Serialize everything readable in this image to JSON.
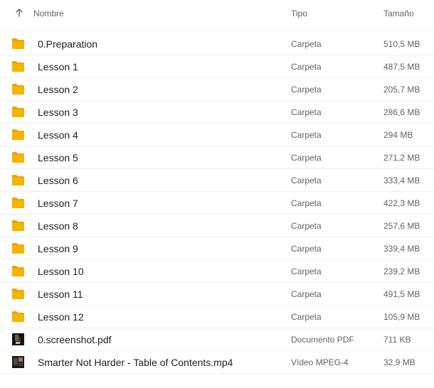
{
  "header": {
    "sort_icon": "arrow-up-icon",
    "name_label": "Nombre",
    "type_label": "Tipo",
    "size_label": "Tamaño"
  },
  "colors": {
    "folder": "#f5b400",
    "folder_dark": "#e8a200",
    "text": "#202124",
    "secondary_text": "#5f6368",
    "divider": "#eeeff1"
  },
  "items": [
    {
      "name": "0.Preparation",
      "type": "Carpeta",
      "size": "510,5 MB",
      "icon": "folder-icon"
    },
    {
      "name": "Lesson 1",
      "type": "Carpeta",
      "size": "487,5 MB",
      "icon": "folder-icon"
    },
    {
      "name": "Lesson 2",
      "type": "Carpeta",
      "size": "205,7 MB",
      "icon": "folder-icon"
    },
    {
      "name": "Lesson 3",
      "type": "Carpeta",
      "size": "286,6 MB",
      "icon": "folder-icon"
    },
    {
      "name": "Lesson 4",
      "type": "Carpeta",
      "size": "294 MB",
      "icon": "folder-icon"
    },
    {
      "name": "Lesson 5",
      "type": "Carpeta",
      "size": "271,2 MB",
      "icon": "folder-icon"
    },
    {
      "name": "Lesson 6",
      "type": "Carpeta",
      "size": "333,4 MB",
      "icon": "folder-icon"
    },
    {
      "name": "Lesson 7",
      "type": "Carpeta",
      "size": "422,3 MB",
      "icon": "folder-icon"
    },
    {
      "name": "Lesson 8",
      "type": "Carpeta",
      "size": "257,6 MB",
      "icon": "folder-icon"
    },
    {
      "name": "Lesson 9",
      "type": "Carpeta",
      "size": "339,4 MB",
      "icon": "folder-icon"
    },
    {
      "name": "Lesson 10",
      "type": "Carpeta",
      "size": "239,2 MB",
      "icon": "folder-icon"
    },
    {
      "name": "Lesson 11",
      "type": "Carpeta",
      "size": "491,5 MB",
      "icon": "folder-icon"
    },
    {
      "name": "Lesson 12",
      "type": "Carpeta",
      "size": "105,9 MB",
      "icon": "folder-icon"
    },
    {
      "name": "0.screenshot.pdf",
      "type": "Documento PDF",
      "size": "711 KB",
      "icon": "pdf-thumbnail-icon"
    },
    {
      "name": "Smarter Not Harder - Table of Contents.mp4",
      "type": "Vídeo MPEG-4",
      "size": "32,9 MB",
      "icon": "video-thumbnail-icon"
    }
  ]
}
